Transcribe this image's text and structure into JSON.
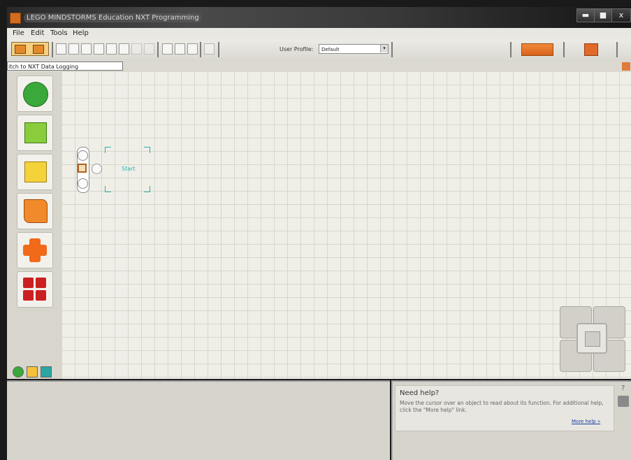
{
  "window": {
    "title": "LEGO MINDSTORMS Education NXT Programming",
    "minimize": "▬",
    "maximize": "■",
    "close": "x"
  },
  "menu": {
    "items": [
      "File",
      "Edit",
      "Tools",
      "Help"
    ]
  },
  "toolbar": {
    "user_profile_label": "User Profile:",
    "user_profile_value": "Default",
    "dropdown_arrow": "▾"
  },
  "tabs": {
    "tooltip": "itch to NXT Data Logging"
  },
  "canvas": {
    "start_label": "Start"
  },
  "help": {
    "title": "Need help?",
    "text": "Move the cursor over an object to read about its function. For additional help, click the \"More help\" link.",
    "more_link": "More help »",
    "question_mark": "?"
  },
  "colors": {
    "orange_accent": "#d8621a",
    "start_teal": "#29b0a8",
    "palette_green": "#3aa83a",
    "palette_red": "#cc2020"
  },
  "icons": [
    "app-icon",
    "new-icon",
    "open-icon",
    "save-icon",
    "cut-icon",
    "copy-icon",
    "paste-icon",
    "undo-icon",
    "redo-icon",
    "pointer-icon",
    "pan-icon",
    "comment-icon",
    "custom-palette-icon",
    "nxt-window-icon",
    "download-icon"
  ]
}
